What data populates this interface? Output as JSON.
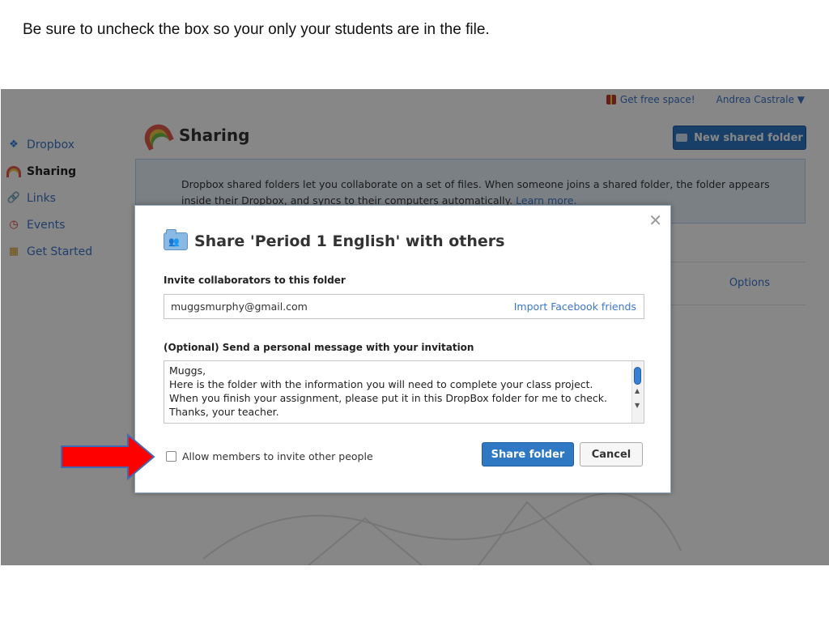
{
  "caption": "Be sure to uncheck the box so your only your students are in the file.",
  "topbar": {
    "free_space": "Get free space!",
    "user_name": "Andrea Castrale ▼"
  },
  "sidebar": {
    "items": [
      {
        "label": "Dropbox",
        "icon": "dropbox-icon"
      },
      {
        "label": "Sharing",
        "icon": "rainbow-icon",
        "active": true
      },
      {
        "label": "Links",
        "icon": "link-icon"
      },
      {
        "label": "Events",
        "icon": "clock-icon"
      },
      {
        "label": "Get Started",
        "icon": "cake-icon"
      }
    ]
  },
  "page": {
    "title": "Sharing",
    "new_folder_label": "New shared folder",
    "info_text": "Dropbox shared folders let you collaborate on a set of files. When someone joins a shared folder, the folder appears inside their Dropbox, and syncs to their computers automatically.",
    "learn_more": "Learn more.",
    "options_label": "Options"
  },
  "modal": {
    "title": "Share 'Period 1 English' with others",
    "invite_label": "Invite collaborators to this folder",
    "email_value": "muggsmurphy@gmail.com",
    "import_link": "Import Facebook friends",
    "message_label": "(Optional) Send a personal message with your invitation",
    "message_text": "Muggs,\nHere is the folder with the information you will need to complete your class project. When you finish your assignment, please put it in this DropBox folder for me to check. Thanks, your teacher.",
    "checkbox_label": "Allow members to invite other people",
    "checkbox_checked": false,
    "share_button": "Share folder",
    "cancel_button": "Cancel"
  },
  "colors": {
    "accent": "#2f78c4",
    "link": "#3d76c8",
    "arrow": "#ff0000"
  }
}
